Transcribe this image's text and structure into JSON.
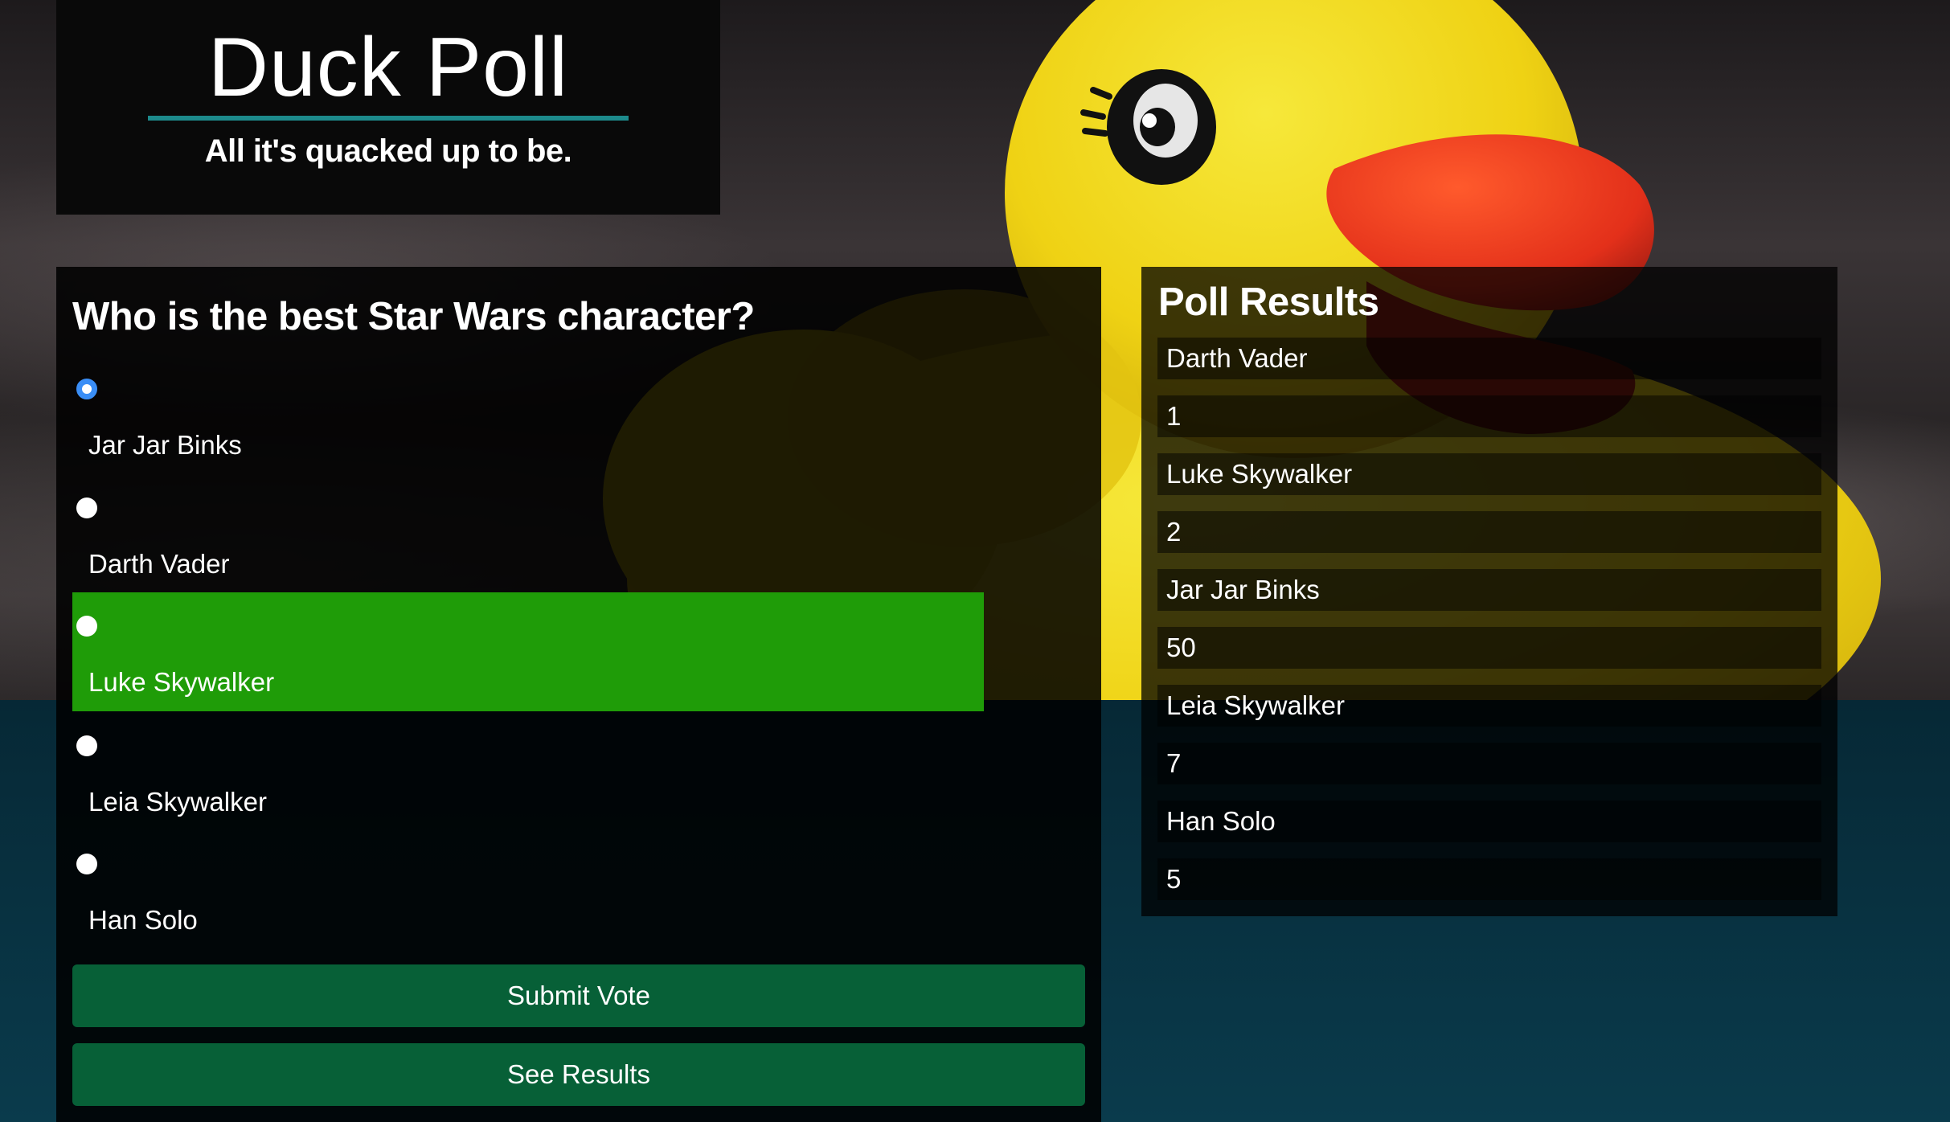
{
  "brand": {
    "title": "Duck Poll",
    "tagline": "All it's quacked up to be."
  },
  "poll": {
    "question": "Who is the best Star Wars character?",
    "options": [
      {
        "label": "Jar Jar Binks",
        "checked": true,
        "highlighted": false
      },
      {
        "label": "Darth Vader",
        "checked": false,
        "highlighted": false
      },
      {
        "label": "Luke Skywalker",
        "checked": false,
        "highlighted": true
      },
      {
        "label": "Leia Skywalker",
        "checked": false,
        "highlighted": false
      },
      {
        "label": "Han Solo",
        "checked": false,
        "highlighted": false
      }
    ],
    "submit_label": "Submit Vote",
    "results_label": "See Results"
  },
  "results": {
    "title": "Poll Results",
    "rows": [
      {
        "name": "Darth Vader",
        "votes": "1"
      },
      {
        "name": "Luke Skywalker",
        "votes": "2"
      },
      {
        "name": "Jar Jar Binks",
        "votes": "50"
      },
      {
        "name": "Leia Skywalker",
        "votes": "7"
      },
      {
        "name": "Han Solo",
        "votes": "5"
      }
    ]
  },
  "colors": {
    "accent_rule": "#1d8a8c",
    "highlight": "#1f9c08",
    "button": "#076037",
    "radio_checked": "#3a8ef6"
  },
  "background_image": "rubber-duck-photo"
}
